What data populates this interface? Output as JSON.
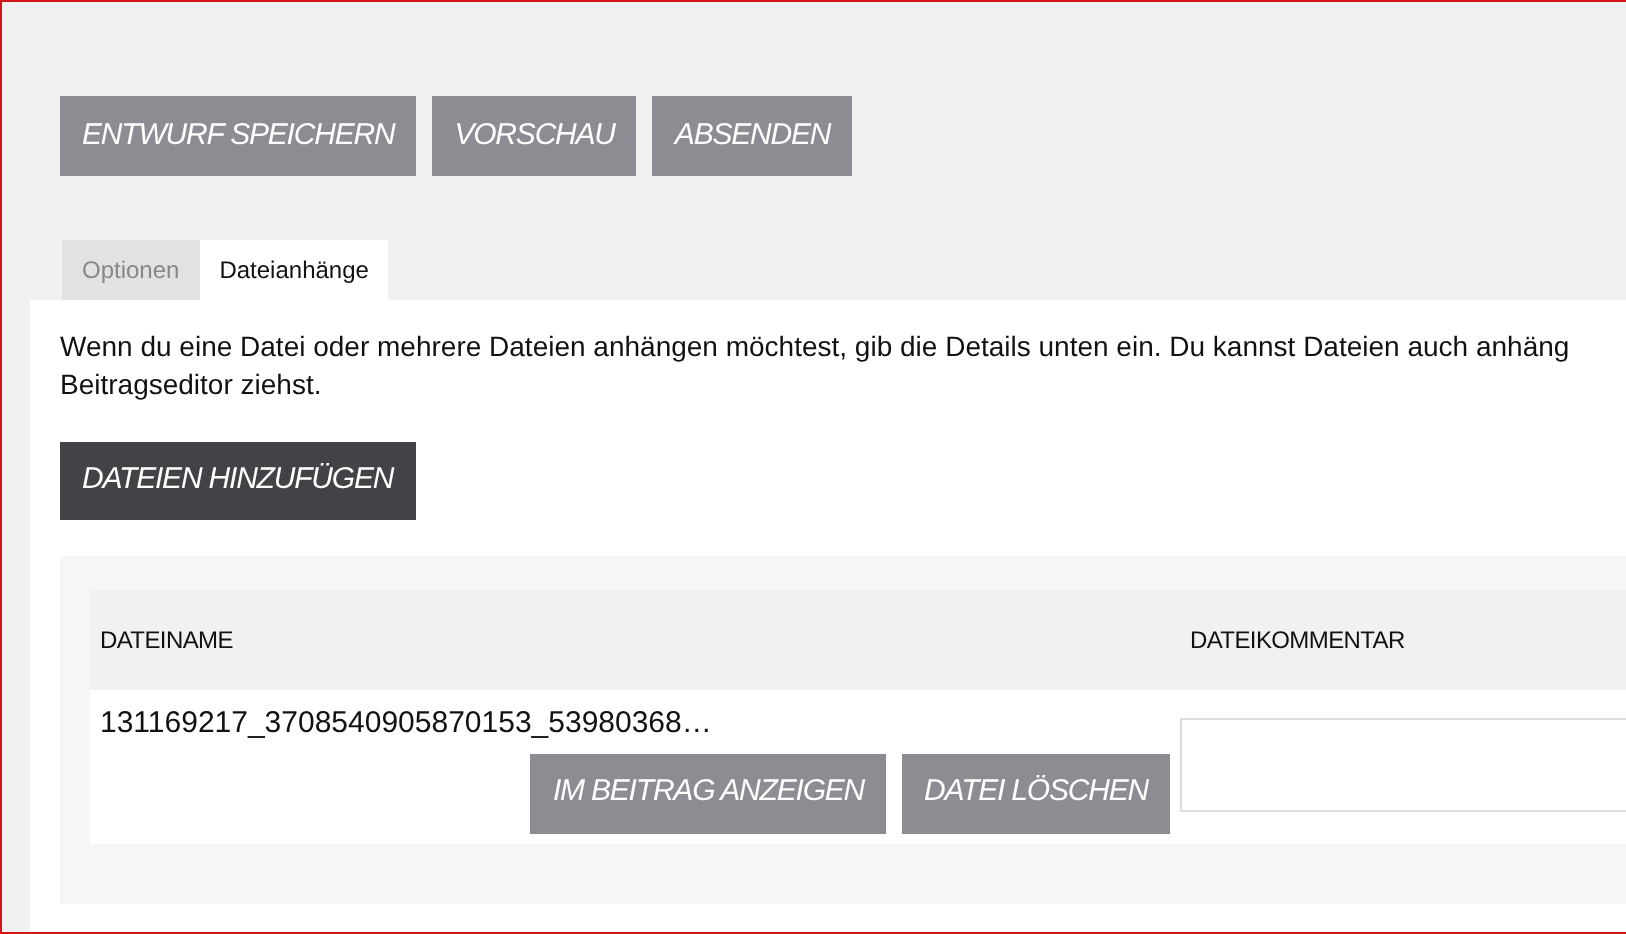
{
  "toolbar_buttons": [
    "ENTWURF SPEICHERN",
    "VORSCHAU",
    "ABSENDEN"
  ],
  "tabs": [
    {
      "label": "Optionen",
      "selected": false
    },
    {
      "label": "Dateianhänge",
      "selected": true
    }
  ],
  "intro_lines": [
    "Wenn du eine Datei oder mehrere Dateien anhängen möchtest, gib die Details unten ein. Du kannst Dateien auch anhäng",
    "Beitragseditor ziehst."
  ],
  "add_button": "DATEIEN HINZUFÜGEN",
  "table": {
    "columns": [
      "DATEINAME",
      "DATEIKOMMENTAR"
    ],
    "rows": [
      {
        "filename": "131169217_3708540905870153_53980368…",
        "actions": [
          "IM BEITRAG ANZEIGEN",
          "DATEI LÖSCHEN"
        ]
      }
    ]
  }
}
